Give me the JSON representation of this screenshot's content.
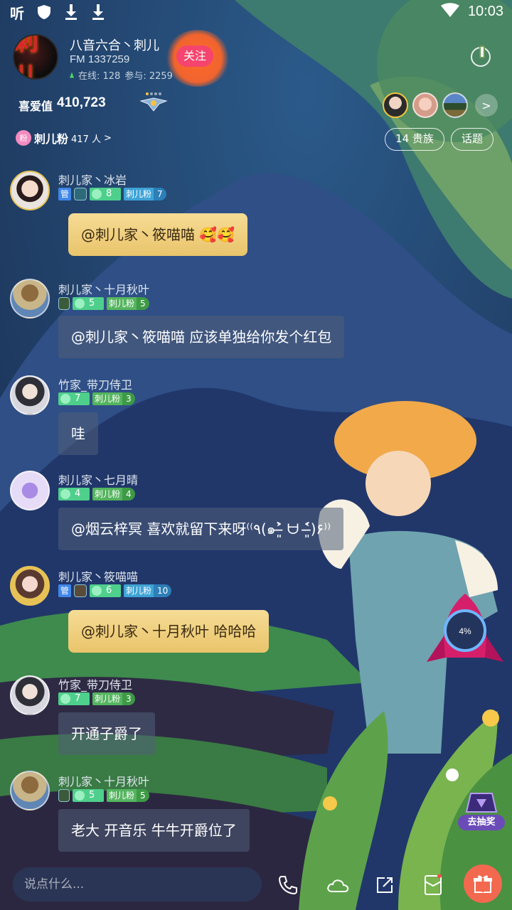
{
  "status_bar": {
    "time": "10:03",
    "app_icon_text": "听"
  },
  "room": {
    "avatar_text": "刺儿",
    "name": "八音六合丶刺儿",
    "fm": "FM 1337259",
    "online": "在线: 128",
    "participation": "参与: 2259",
    "follow_label": "关注",
    "heat_label": "喜爱值",
    "heat_value": "410,723",
    "fans_club_badge": "粉",
    "fans_club_name": "刺儿粉",
    "fans_club_count": "417 人",
    "fans_club_chevron": ">",
    "nobility_label": "14 贵族",
    "topic_label": "话题",
    "more_fans_chevron": ">"
  },
  "messages": [
    {
      "user": "刺儿家丶冰岩",
      "admin": "管",
      "level": "8",
      "fan_name": "刺儿粉",
      "fan_level": "7",
      "text": "@刺儿家丶筱喵喵 🥰🥰",
      "style": "gold"
    },
    {
      "user": "刺儿家丶十月秋叶",
      "level": "5",
      "fan_name": "刺儿粉",
      "fan_level": "5",
      "text": "@刺儿家丶筱喵喵 应该单独给你发个红包",
      "style": "plain"
    },
    {
      "user": "竹家_带刀侍卫",
      "level": "7",
      "fan_name": "刺儿粉",
      "fan_level": "3",
      "text": "哇",
      "style": "plain"
    },
    {
      "user": "刺儿家丶七月晴",
      "level": "4",
      "fan_name": "刺儿粉",
      "fan_level": "4",
      "text": "@烟云梓冥 喜欢就留下来呀⁽⁽٩(๑˃̶͈̀ ᗨ ˂̶͈́)۶⁾⁾",
      "style": "plain"
    },
    {
      "user": "刺儿家丶筱喵喵",
      "admin": "管",
      "level": "6",
      "fan_name": "刺儿粉",
      "fan_level": "10",
      "text": "@刺儿家丶十月秋叶 哈哈哈",
      "style": "gold"
    },
    {
      "user": "竹家_带刀侍卫",
      "level": "7",
      "fan_name": "刺儿粉",
      "fan_level": "3",
      "text": "开通子爵了",
      "style": "plain"
    },
    {
      "user": "刺儿家丶十月秋叶",
      "level": "5",
      "fan_name": "刺儿粉",
      "fan_level": "5",
      "text": "老大 开音乐 牛牛开爵位了",
      "style": "plain"
    }
  ],
  "rocket": {
    "progress": "4%"
  },
  "lottery": {
    "label": "去抽奖"
  },
  "input": {
    "placeholder": "说点什么..."
  },
  "icons": {
    "call": "phone-call-icon",
    "cloud": "cloud-icon",
    "share": "share-icon",
    "envelope": "red-envelope-icon",
    "gift": "gift-icon"
  },
  "colors": {
    "follow": "#f5446e",
    "gift": "#f2694f",
    "gold_bubble": "#f6dc95"
  }
}
